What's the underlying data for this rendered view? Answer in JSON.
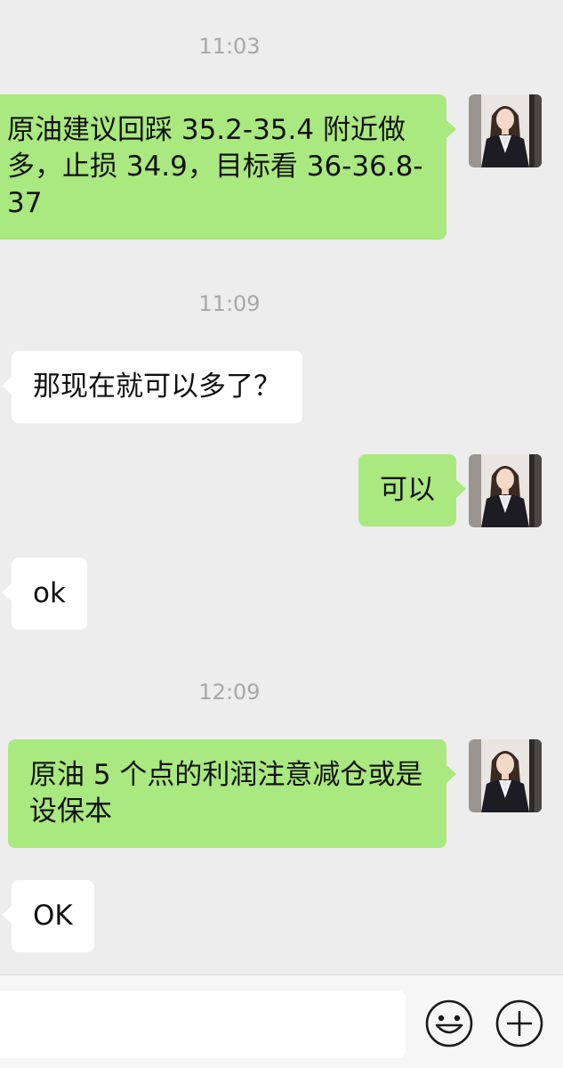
{
  "messages": [
    {
      "type": "time",
      "text": "11:03"
    },
    {
      "type": "out",
      "text": "原油建议回踩 35.2-35.4 附近做多，止损 34.9，目标看 36-36.8-37"
    },
    {
      "type": "time",
      "text": "11:09"
    },
    {
      "type": "in",
      "text": "那现在就可以多了？"
    },
    {
      "type": "out",
      "text": "可以"
    },
    {
      "type": "in",
      "text": "ok"
    },
    {
      "type": "time",
      "text": "12:09"
    },
    {
      "type": "out",
      "text": "原油 5 个点的利润注意减仓或是设保本"
    },
    {
      "type": "in",
      "text": "OK"
    }
  ],
  "input_bar": {
    "placeholder": "",
    "emoji_icon": "smiley-icon",
    "more_icon": "plus-circle-icon"
  },
  "colors": {
    "background": "#ededed",
    "outgoing_bubble": "#a9e97f",
    "incoming_bubble": "#ffffff",
    "timestamp_text": "#a8a8a8"
  }
}
